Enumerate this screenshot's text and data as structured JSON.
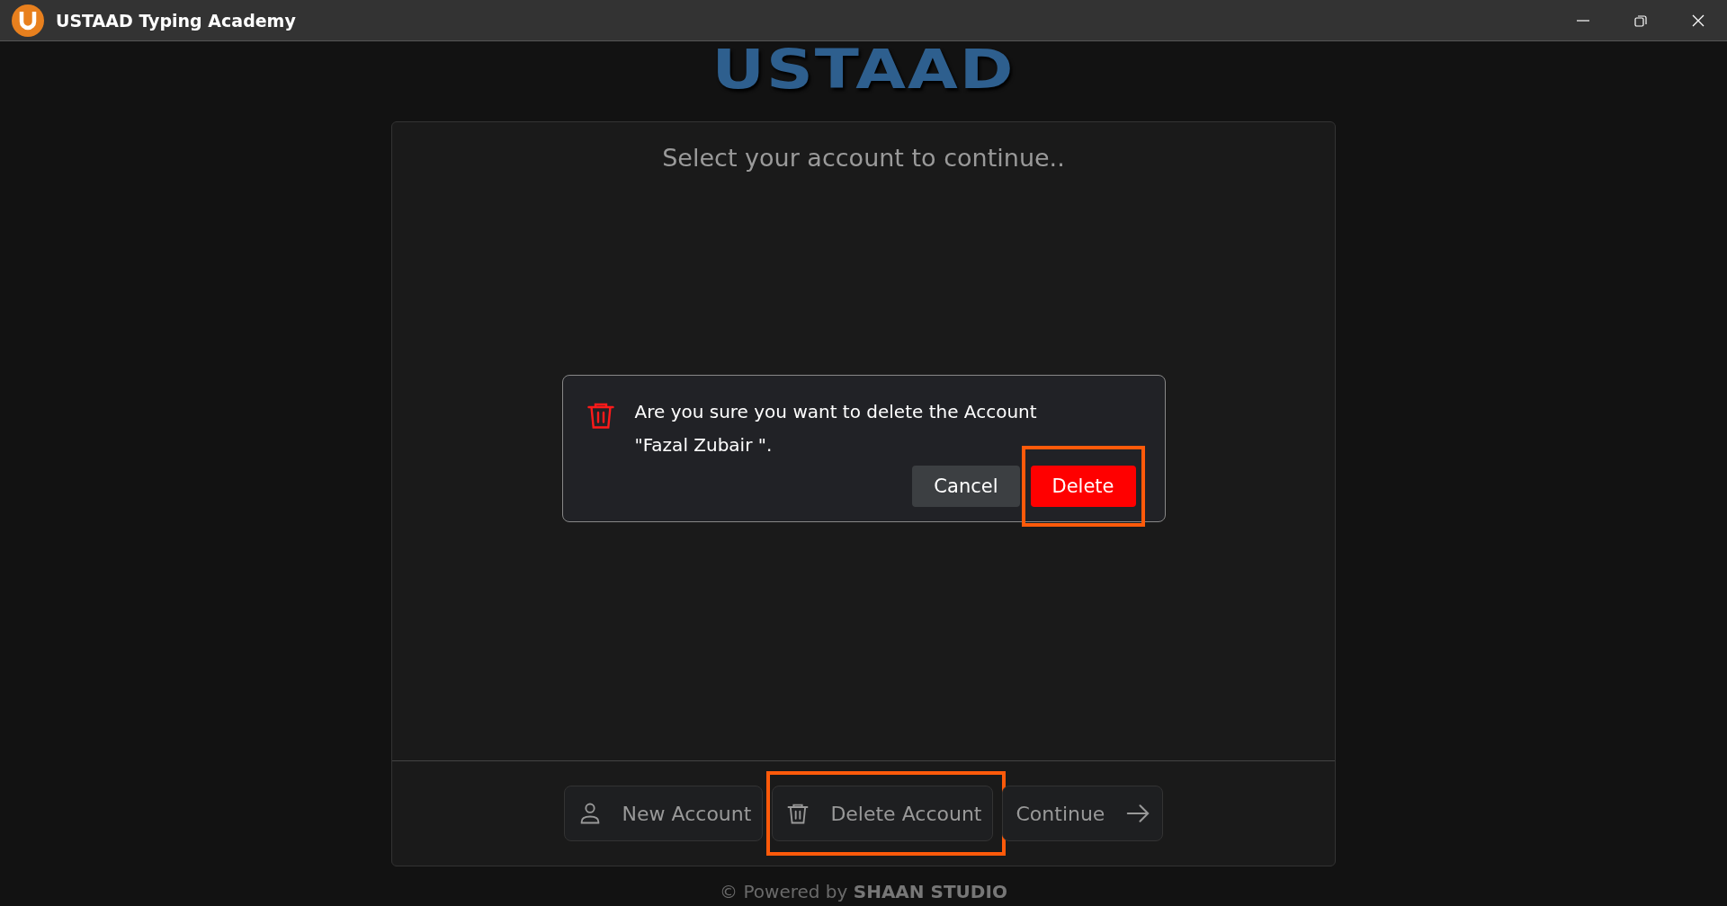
{
  "window": {
    "title": "USTAAD Typing Academy"
  },
  "logo": {
    "text": "USTAAD"
  },
  "card": {
    "title": "Select your account to continue.."
  },
  "dialog": {
    "message": "Are you sure you want to delete the Account \"Fazal Zubair \".",
    "buttons": [
      {
        "label": "Cancel",
        "kind": "secondary",
        "highlighted": false
      },
      {
        "label": "Delete",
        "kind": "danger",
        "highlighted": true
      }
    ]
  },
  "actions": [
    {
      "label": "New Account",
      "highlighted": false
    },
    {
      "label": "Delete Account",
      "highlighted": true
    },
    {
      "label": "Continue",
      "highlighted": false
    }
  ],
  "footer": {
    "text": "© Powered by **SHAAN STUDIO**"
  }
}
